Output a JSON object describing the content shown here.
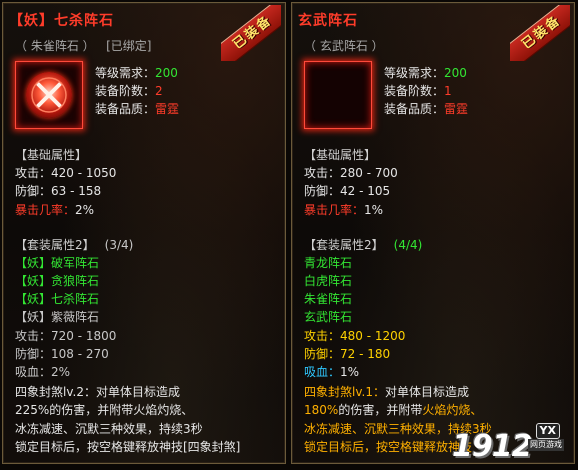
{
  "left": {
    "title_tag": "【妖】",
    "title_name": "七杀阵石",
    "subtitle": "（ 朱雀阵石 ）   [已绑定]",
    "stamp": "已装备",
    "level_label": "等级需求：",
    "level_value": "200",
    "tier_label": "装备阶数：",
    "tier_value": "2",
    "quality_label": "装备品质：",
    "quality_value": "雷霆",
    "basic_head": "【基础属性】",
    "atk": "攻击：420 - 1050",
    "def": "防御：63 - 158",
    "crit_label": "暴击几率：",
    "crit_value": "2%",
    "set_head": "【套装属性2】",
    "set_count": "(3/4)",
    "set_items": [
      "【妖】破军阵石",
      "【妖】贪狼阵石",
      "【妖】七杀阵石",
      "【妖】紫薇阵石"
    ],
    "set_atk": "攻击：720 - 1800",
    "set_def": "防御：108 - 270",
    "set_leech": "吸血：2%",
    "skill_name": "四象封煞lv.2：",
    "skill_l1": "对单体目标造成",
    "skill_l2": "225%的伤害，并附带火焰灼烧、",
    "skill_l3": "冰冻减速、沉默三种效果，持续3秒",
    "skill_l4": "锁定目标后，按空格键释放神技[四象封煞]"
  },
  "right": {
    "title_name": "玄武阵石",
    "subtitle": "（ 玄武阵石 ）",
    "stamp": "已装备",
    "level_label": "等级需求：",
    "level_value": "200",
    "tier_label": "装备阶数：",
    "tier_value": "1",
    "quality_label": "装备品质：",
    "quality_value": "雷霆",
    "basic_head": "【基础属性】",
    "atk": "攻击：280 - 700",
    "def": "防御：42 - 105",
    "crit_label": "暴击几率：",
    "crit_value": "1%",
    "set_head": "【套装属性2】",
    "set_count": "(4/4)",
    "set_items": [
      "青龙阵石",
      "白虎阵石",
      "朱雀阵石",
      "玄武阵石"
    ],
    "set_atk": "攻击：480 - 1200",
    "set_def": "防御：72 - 180",
    "set_leech_label": "吸血：",
    "set_leech_value": "1%",
    "skill_name": "四象封煞lv.1：",
    "skill_l1": "对单体目标造成",
    "skill_l2a": "180%",
    "skill_l2b": "的伤害，并附带",
    "skill_l2c": "火焰灼烧、",
    "skill_l3a": "冰冻减速、沉默三种效果，持续",
    "skill_l3b": "3秒",
    "skill_l4a": "锁定目标后，按空格键",
    "skill_l4b": "释放神技"
  },
  "logo": {
    "number": "1912",
    "badge": "YX",
    "sub": "网页游戏"
  },
  "colors": {
    "green": "#33e633",
    "red": "#ff3c2a",
    "yellow": "#ffd200",
    "cyan": "#2fc8ff"
  }
}
